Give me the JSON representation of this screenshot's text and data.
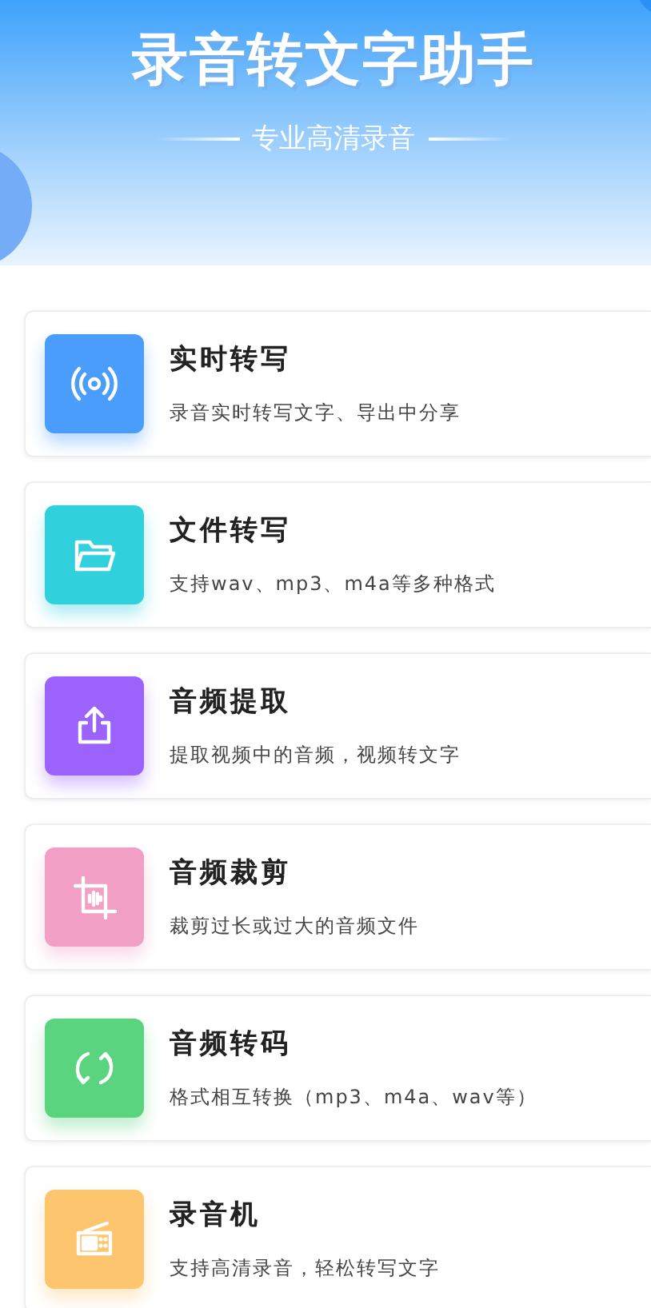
{
  "header": {
    "title": "录音转文字助手",
    "subtitle": "专业高清录音"
  },
  "features": [
    {
      "title": "实时转写",
      "description": "录音实时转写文字、导出中分享",
      "kind": "signal",
      "color": "#4a9dfb"
    },
    {
      "title": "文件转写",
      "description": "支持wav、mp3、m4a等多种格式",
      "kind": "folder",
      "color": "#30d0dc"
    },
    {
      "title": "音频提取",
      "description": "提取视频中的音频，视频转文字",
      "kind": "share",
      "color": "#9b63fb"
    },
    {
      "title": "音频裁剪",
      "description": "裁剪过长或过大的音频文件",
      "kind": "crop",
      "color": "#f19fc5"
    },
    {
      "title": "音频转码",
      "description": "格式相互转换（mp3、m4a、wav等）",
      "kind": "convert",
      "color": "#5bd47f"
    },
    {
      "title": "录音机",
      "description": "支持高清录音，轻松转写文字",
      "kind": "radio",
      "color": "#fdc56e"
    }
  ]
}
